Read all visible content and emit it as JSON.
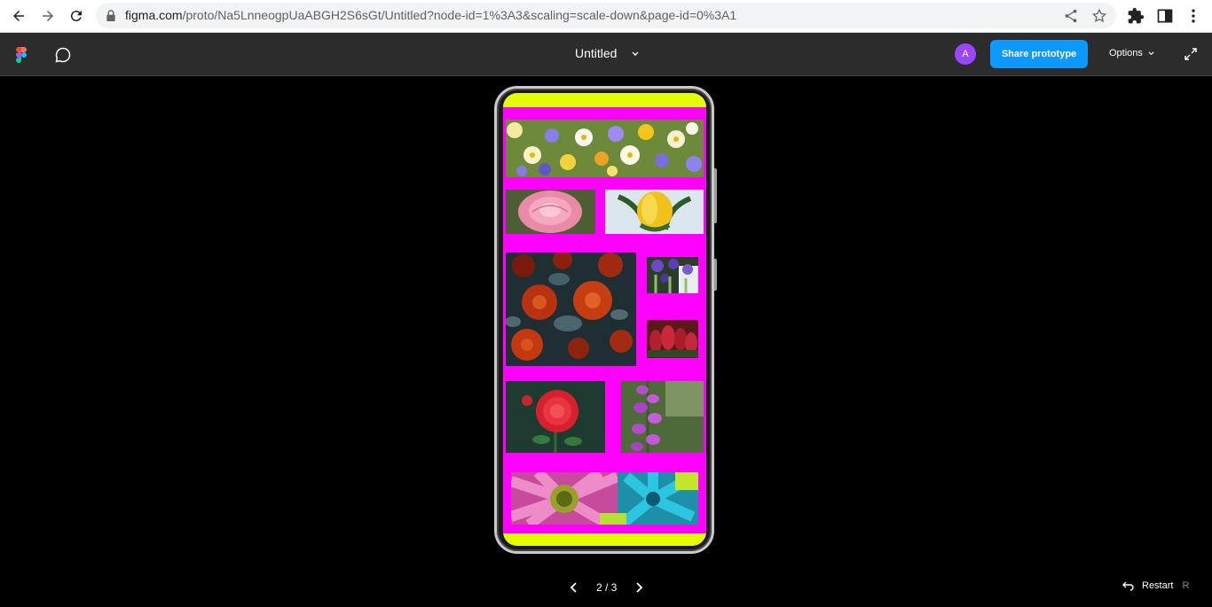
{
  "browser": {
    "url_host": "figma.com",
    "url_path": "/proto/Na5LnneogpUaABGH2S6sGt/Untitled?node-id=1%3A3&scaling=scale-down&page-id=0%3A1",
    "icons": [
      "back-icon",
      "forward-icon",
      "reload-icon",
      "lock-icon",
      "share-icon",
      "star-icon",
      "extensions-icon",
      "side-panel-icon",
      "menu-icon"
    ]
  },
  "toolbar": {
    "title": "Untitled",
    "avatar_initial": "A",
    "share_label": "Share prototype",
    "options_label": "Options"
  },
  "colors": {
    "screen_background": "#ff00ff",
    "screen_bars": "#e5ff00",
    "share_button": "#0d99ff",
    "avatar": "#9747ff"
  },
  "footer": {
    "page_indicator": "2 / 3",
    "restart_label": "Restart",
    "restart_key": "R"
  }
}
